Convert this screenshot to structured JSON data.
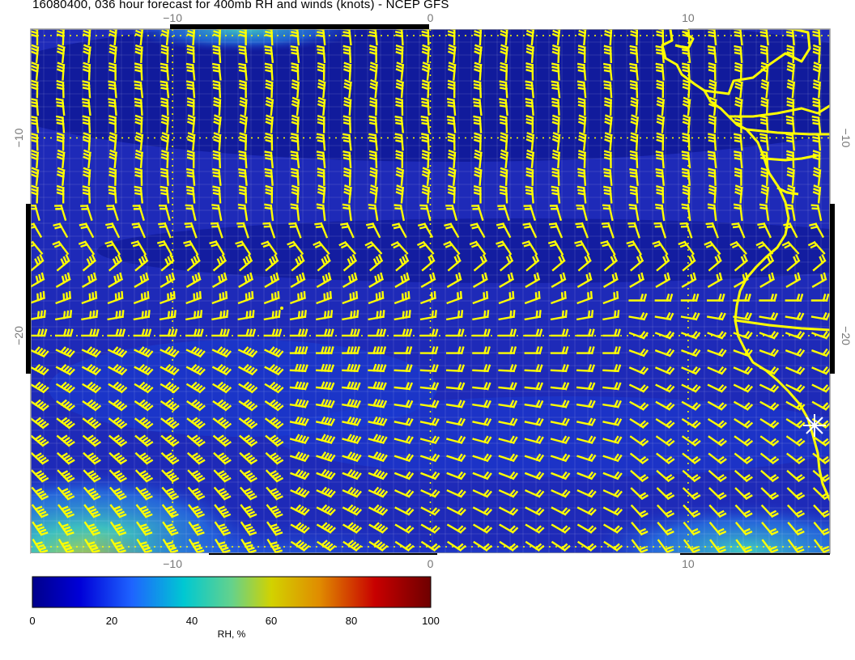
{
  "title": "16080400, 036 hour forecast for 400mb RH and winds (knots) - NCEP GFS",
  "axes": {
    "x_ticks": [
      "−10",
      "0",
      "10"
    ],
    "y_ticks": [
      "−10",
      "−20"
    ],
    "x_tick_values": [
      -10,
      0,
      10
    ],
    "y_tick_values": [
      -10,
      -20
    ],
    "lon_range": [
      -15.5,
      15.5
    ],
    "lat_range": [
      -4.5,
      -31
    ]
  },
  "colorbar": {
    "label": "RH, %",
    "ticks": [
      "0",
      "20",
      "40",
      "60",
      "80",
      "100"
    ],
    "range": [
      0,
      100
    ],
    "colors": [
      "#00008b",
      "#0000d8",
      "#1e64ff",
      "#00c8d2",
      "#64d28c",
      "#d2d200",
      "#e08c00",
      "#c80000",
      "#6e0000"
    ]
  },
  "overlay": {
    "coastline_color": "#ffff00",
    "wind_barb_color": "#ffff00",
    "grid_color": "#ffffff",
    "marker": "station-star-icon"
  }
}
